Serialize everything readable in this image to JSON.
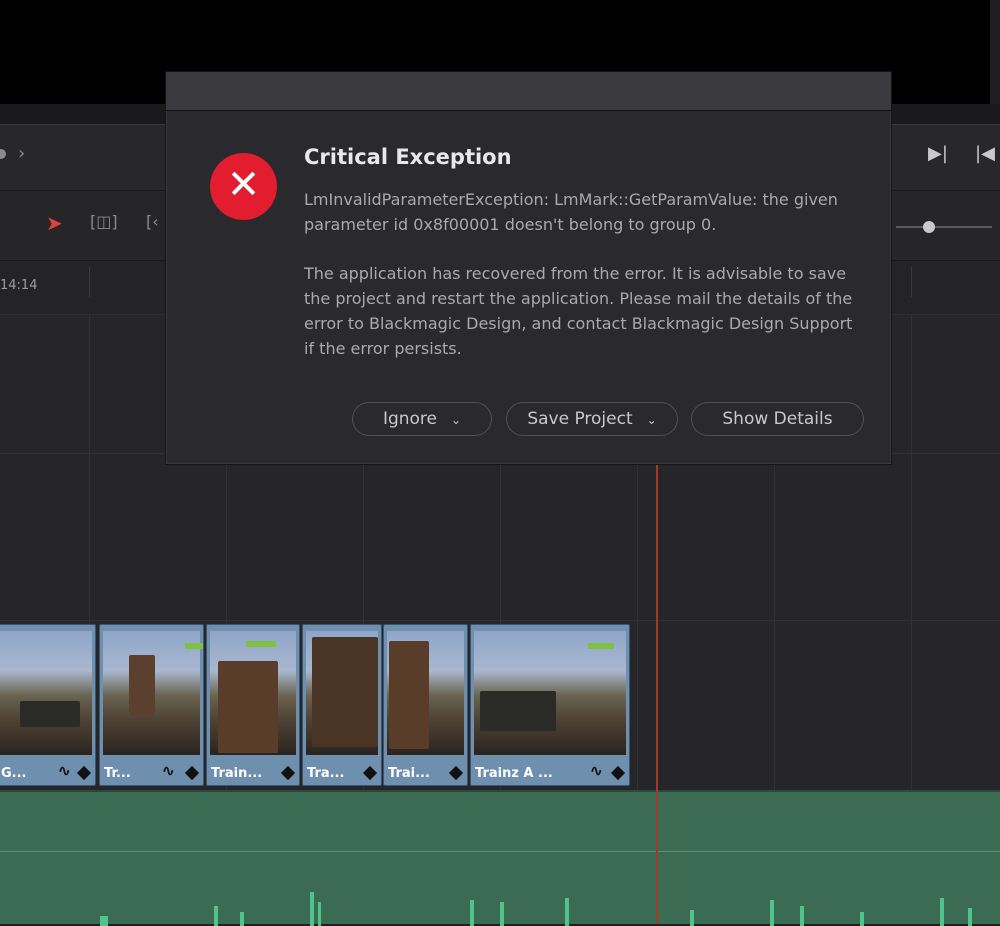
{
  "timeline": {
    "timecode": "14:14"
  },
  "clips": [
    {
      "label": "G..."
    },
    {
      "label": "Tr..."
    },
    {
      "label": "Train..."
    },
    {
      "label": "Tra..."
    },
    {
      "label": "Trai..."
    },
    {
      "label": "Trainz  A ..."
    }
  ],
  "dialog": {
    "title": "Critical Exception",
    "icon": "close-icon",
    "message_1": "LmInvalidParameterException: LmMark::GetParamValue: the given parameter id 0x8f00001 doesn't belong to group 0.",
    "message_2": "The application has recovered from the error. It is advisable to save the project and restart the application. Please mail the details of the error to Blackmagic Design, and contact Blackmagic Design Support if the error persists.",
    "buttons": {
      "ignore": "Ignore",
      "save_project": "Save Project",
      "show_details": "Show Details"
    }
  },
  "colors": {
    "error_red": "#e11d2f",
    "clip_blue": "#6e8fae",
    "audio_green": "#3b6b52",
    "playhead": "#a23a2a",
    "selection_tool": "#e0403a"
  }
}
